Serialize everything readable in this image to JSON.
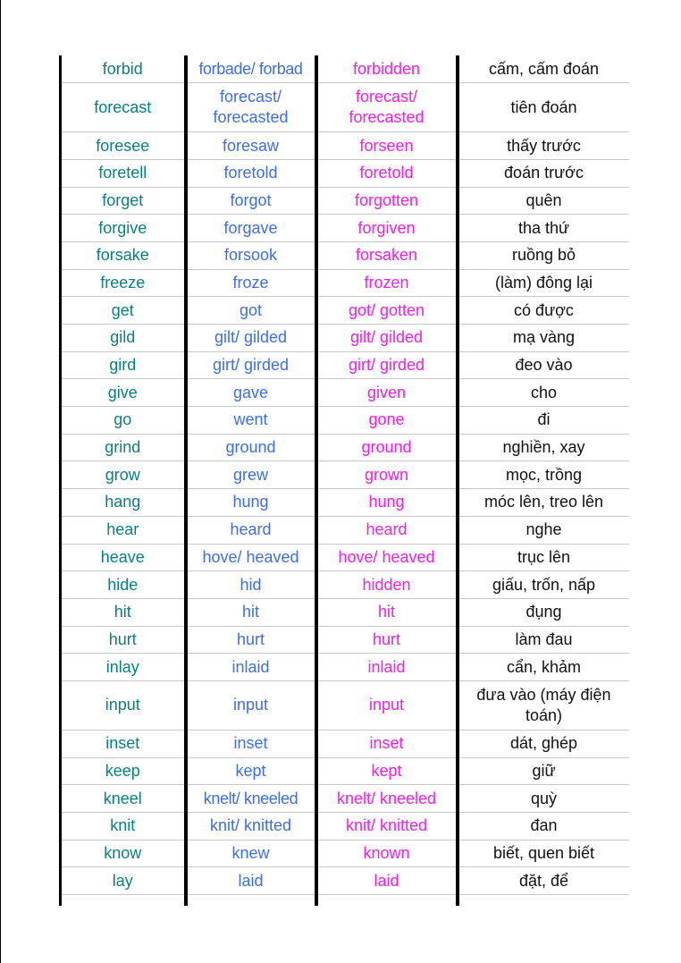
{
  "colors": {
    "base_form": "#078080",
    "past_simple": "#3d6ee8",
    "past_participle": "#f31ee6",
    "meaning": "#111111",
    "rule": "#000000",
    "row_line": "#c8c8c8"
  },
  "rows": [
    {
      "base": "forbid",
      "past": "forbade/ forbad",
      "participle": "forbidden",
      "meaning": "cấm, cấm đoán"
    },
    {
      "base": "forecast",
      "past": "forecast/ forecasted",
      "participle": "forecast/ forecasted",
      "meaning": "tiên đoán"
    },
    {
      "base": "foresee",
      "past": "foresaw",
      "participle": "forseen",
      "meaning": "thấy trước"
    },
    {
      "base": "foretell",
      "past": "foretold",
      "participle": "foretold",
      "meaning": "đoán trước"
    },
    {
      "base": "forget",
      "past": "forgot",
      "participle": "forgotten",
      "meaning": "quên"
    },
    {
      "base": "forgive",
      "past": "forgave",
      "participle": "forgiven",
      "meaning": "tha thứ"
    },
    {
      "base": "forsake",
      "past": "forsook",
      "participle": "forsaken",
      "meaning": "ruồng bỏ"
    },
    {
      "base": "freeze",
      "past": "froze",
      "participle": "frozen",
      "meaning": "(làm) đông lại"
    },
    {
      "base": "get",
      "past": "got",
      "participle": "got/ gotten",
      "meaning": "có được"
    },
    {
      "base": "gild",
      "past": "gilt/ gilded",
      "participle": "gilt/ gilded",
      "meaning": "mạ vàng"
    },
    {
      "base": "gird",
      "past": "girt/ girded",
      "participle": "girt/ girded",
      "meaning": "đeo vào"
    },
    {
      "base": "give",
      "past": "gave",
      "participle": "given",
      "meaning": "cho"
    },
    {
      "base": "go",
      "past": "went",
      "participle": "gone",
      "meaning": "đi"
    },
    {
      "base": "grind",
      "past": "ground",
      "participle": "ground",
      "meaning": "nghiền, xay"
    },
    {
      "base": "grow",
      "past": "grew",
      "participle": "grown",
      "meaning": "mọc, trồng"
    },
    {
      "base": "hang",
      "past": "hung",
      "participle": "hung",
      "meaning": "móc lên, treo lên"
    },
    {
      "base": "hear",
      "past": "heard",
      "participle": "heard",
      "meaning": "nghe"
    },
    {
      "base": "heave",
      "past": "hove/ heaved",
      "participle": "hove/ heaved",
      "meaning": "trục lên"
    },
    {
      "base": "hide",
      "past": "hid",
      "participle": "hidden",
      "meaning": "giấu, trốn, nấp"
    },
    {
      "base": "hit",
      "past": "hit",
      "participle": "hit",
      "meaning": "đụng"
    },
    {
      "base": "hurt",
      "past": "hurt",
      "participle": "hurt",
      "meaning": "làm đau"
    },
    {
      "base": "inlay",
      "past": "inlaid",
      "participle": "inlaid",
      "meaning": "cẩn, khảm"
    },
    {
      "base": "input",
      "past": "input",
      "participle": "input",
      "meaning": "đưa vào (máy điện toán)"
    },
    {
      "base": "inset",
      "past": "inset",
      "participle": "inset",
      "meaning": "dát, ghép"
    },
    {
      "base": "keep",
      "past": "kept",
      "participle": "kept",
      "meaning": "giữ"
    },
    {
      "base": "kneel",
      "past": "knelt/ kneeled",
      "participle": "knelt/ kneeled",
      "meaning": "quỳ"
    },
    {
      "base": "knit",
      "past": "knit/ knitted",
      "participle": "knit/ knitted",
      "meaning": "đan"
    },
    {
      "base": "know",
      "past": "knew",
      "participle": "known",
      "meaning": "biết, quen biết"
    },
    {
      "base": "lay",
      "past": "laid",
      "participle": "laid",
      "meaning": "đặt, để"
    }
  ]
}
